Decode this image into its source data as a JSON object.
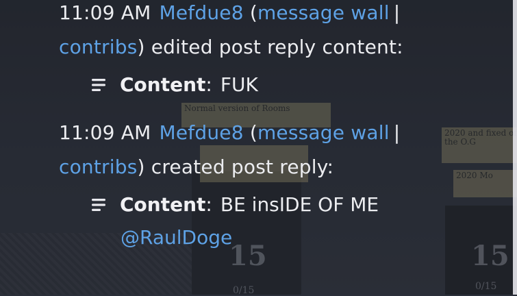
{
  "background": {
    "signs": [
      "Normal version of Rooms",
      "2020 and fixed of the O.G",
      "2020 Mo"
    ],
    "big_numbers": [
      "15",
      "15"
    ],
    "small_numbers": [
      "0/15",
      "0/15"
    ]
  },
  "entries": [
    {
      "time": "11:09 AM",
      "user": "Mefdue8",
      "open_paren": "(",
      "message_wall": "message wall",
      "pipe": "|",
      "contribs": "contribs",
      "close_paren": ")",
      "action": " edited post reply content:",
      "field_label": "Content",
      "field_colon": ":",
      "field_value": "FUK",
      "field_value_extra": ""
    },
    {
      "time": "11:09 AM",
      "user": "Mefdue8",
      "open_paren": "(",
      "message_wall": "message wall",
      "pipe": "|",
      "contribs": "contribs",
      "close_paren": ")",
      "action": " created post reply:",
      "field_label": "Content",
      "field_colon": ":",
      "field_value": "BE insIDE OF ME",
      "field_value_extra": "@RaulDoge"
    }
  ],
  "colors": {
    "link": "#5ea2e6",
    "text": "#ecedf0",
    "background": "#2b2f3a"
  },
  "icons": {
    "content_field": "text-lines-icon"
  }
}
